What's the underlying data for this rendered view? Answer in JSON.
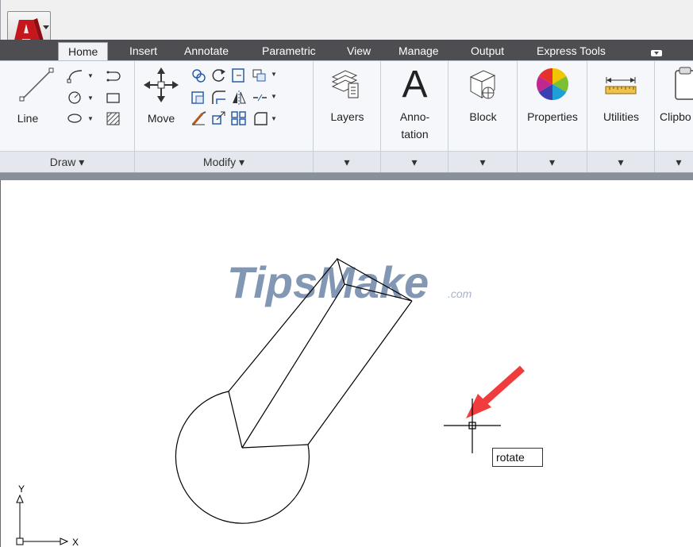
{
  "ribbon_tabs": [
    {
      "label": "Home",
      "active": true
    },
    {
      "label": "Insert"
    },
    {
      "label": "Annotate"
    },
    {
      "label": "Parametric"
    },
    {
      "label": "View"
    },
    {
      "label": "Manage"
    },
    {
      "label": "Output"
    },
    {
      "label": "Express Tools"
    }
  ],
  "panels": {
    "draw": {
      "title": "Draw ▾",
      "line_label": "Line"
    },
    "modify": {
      "title": "Modify ▾",
      "move_label": "Move"
    },
    "layers": {
      "label": "Layers",
      "arrow": "▾"
    },
    "annotation": {
      "label_line1": "Anno-",
      "label_line2": "tation",
      "glyph": "A",
      "arrow": "▾"
    },
    "block": {
      "label": "Block",
      "arrow": "▾"
    },
    "properties": {
      "label": "Properties",
      "arrow": "▾"
    },
    "utilities": {
      "label": "Utilities",
      "arrow": "▾"
    },
    "clipboard": {
      "label": "Clipbo",
      "arrow": "▾"
    }
  },
  "watermark": {
    "main": "TipsMake",
    "suffix": ".com"
  },
  "command_input": {
    "value": "rotate"
  },
  "ucs": {
    "y": "Y",
    "x": "X"
  },
  "colors": {
    "tabbar": "#4e4e52",
    "ribbon": "#f5f7fa",
    "pointer_arrow": "#f03c3c",
    "watermark": "#6d86a8",
    "app_logo": "#c4161c"
  }
}
